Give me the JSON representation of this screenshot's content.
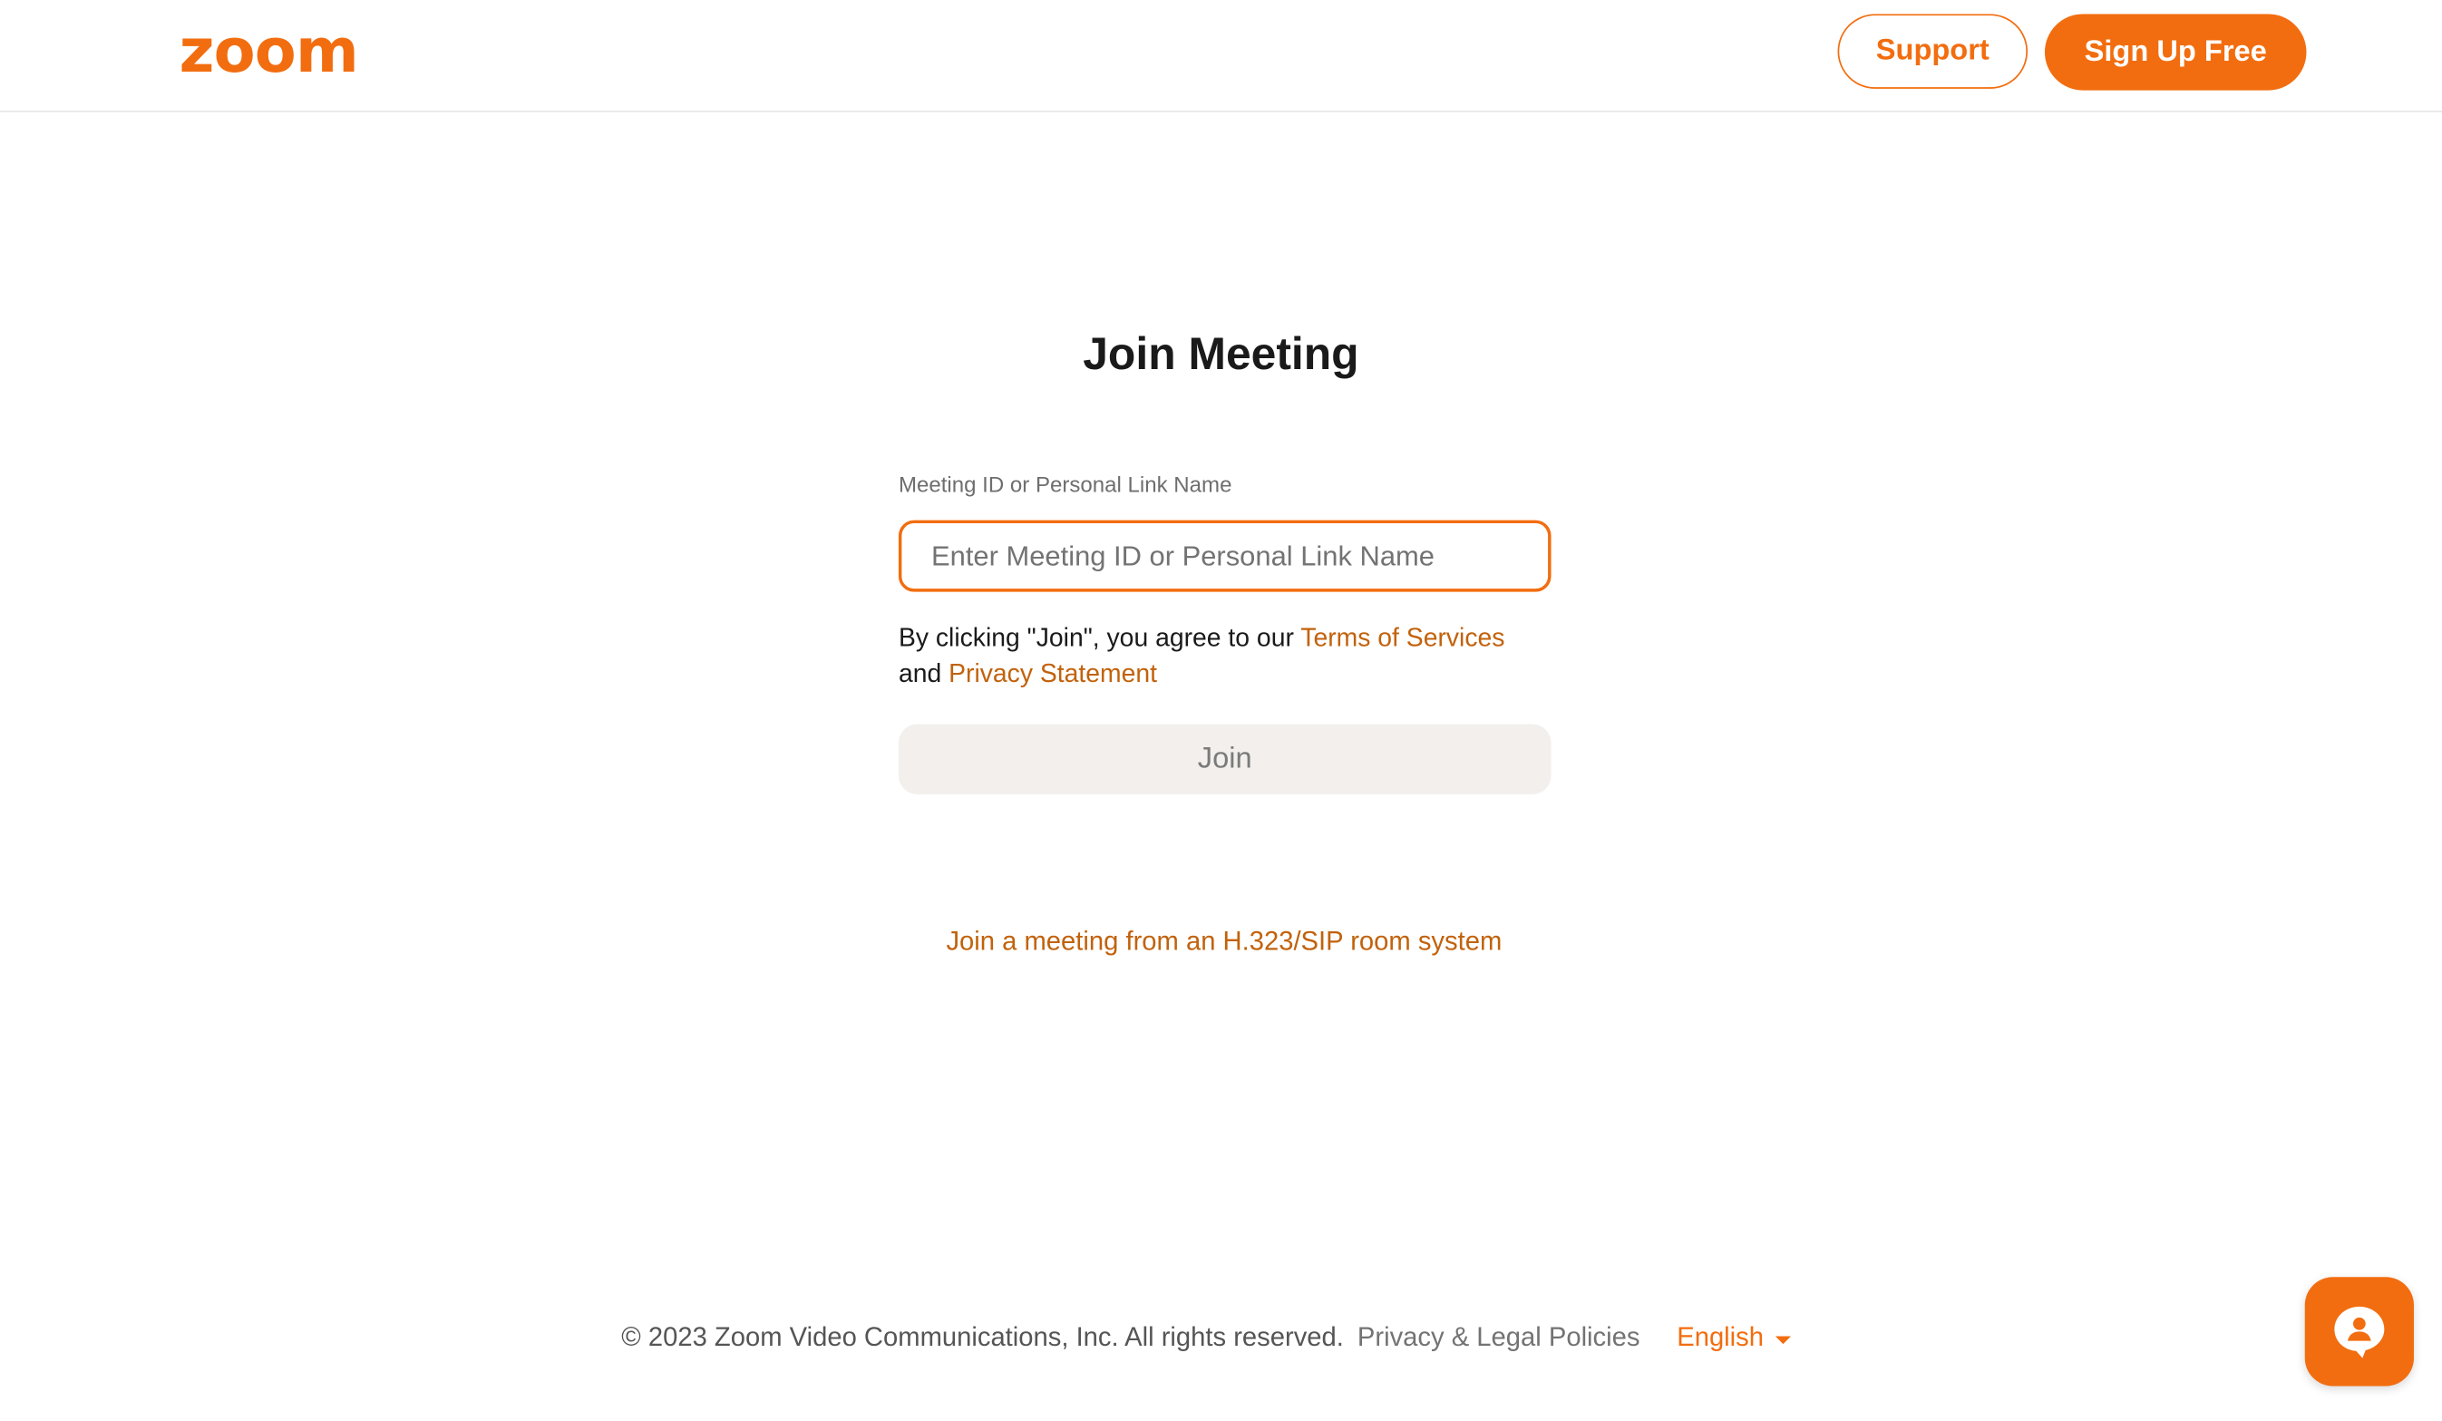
{
  "header": {
    "logo_text": "zoom",
    "support_label": "Support",
    "signup_label": "Sign Up Free"
  },
  "main": {
    "title": "Join Meeting",
    "field_label": "Meeting ID or Personal Link Name",
    "input_placeholder": "Enter Meeting ID or Personal Link Name",
    "input_value": "",
    "agree_prefix": "By clicking \"Join\", you agree to our ",
    "terms_link": "Terms of Services",
    "agree_and": "and ",
    "privacy_link": "Privacy Statement",
    "join_label": "Join",
    "sip_link": "Join a meeting from an H.323/SIP room system"
  },
  "footer": {
    "copyright": "© 2023 Zoom Video Communications, Inc. All rights reserved.",
    "policies_link": "Privacy & Legal Policies",
    "language": "English"
  },
  "chat": {
    "icon": "chat-support-icon"
  },
  "colors": {
    "brand": "#f26d0f",
    "link": "#c2620c",
    "join_disabled_bg": "#f2efec"
  }
}
